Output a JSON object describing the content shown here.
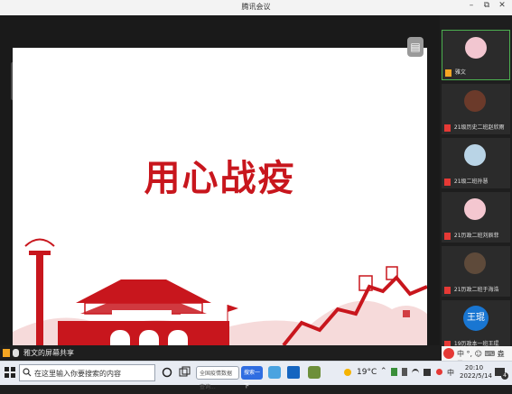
{
  "window": {
    "title": "腾讯会议",
    "controls": [
      "–",
      "⧉",
      "✕"
    ]
  },
  "slide": {
    "title": "用心战疫"
  },
  "participants": [
    {
      "name": "雅文",
      "active": true,
      "avatar_color": "#f2c6d0"
    },
    {
      "name": "21级历史二班赵欣雨",
      "avatar_color": "#6b3a2a"
    },
    {
      "name": "21级二班孙慧",
      "avatar_color": "#b9d4e6"
    },
    {
      "name": "21历政二班刘辰菲",
      "avatar_color": "#f4c7d0"
    },
    {
      "name": "21历政二班于海浩",
      "avatar_color": "#5e4a3a"
    },
    {
      "name": "19历政本一班王琨",
      "avatar_text": "王琨",
      "avatar_color": "#1976d2"
    }
  ],
  "share": {
    "label": "雅文的屏幕共享"
  },
  "ime": {
    "text": "中 °, ☺ ⌨ 盎 ⊞"
  },
  "taskbar": {
    "search_placeholder": "在这里输入你要搜索的内容",
    "mini_search": "全国疫情数据查询...",
    "mini_btn": "搜索一下",
    "weather": "19°C",
    "time": "20:10",
    "date": "2022/5/14",
    "notification_count": "4"
  }
}
